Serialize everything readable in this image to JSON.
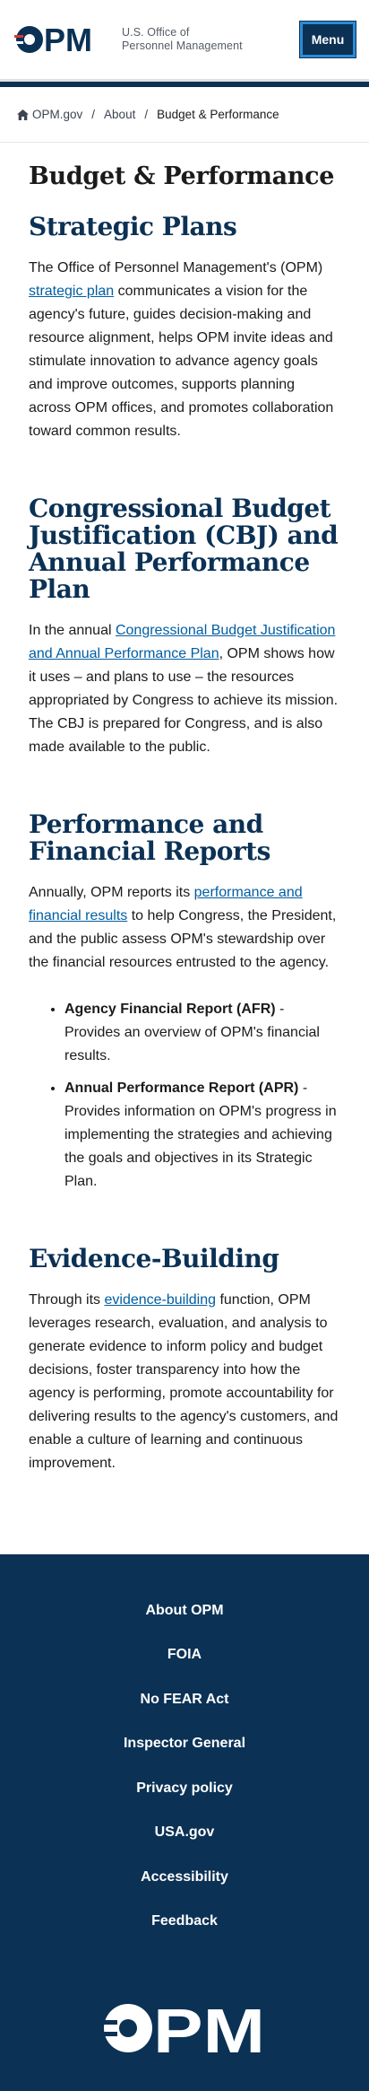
{
  "header": {
    "logo_text": "OPM",
    "org_line1": "U.S. Office of",
    "org_line2": "Personnel Management",
    "menu_label": "Menu"
  },
  "breadcrumb": {
    "home": "OPM.gov",
    "about": "About",
    "current": "Budget & Performance",
    "separator": "/"
  },
  "page": {
    "title": "Budget & Performance"
  },
  "sections": {
    "strategic": {
      "heading": "Strategic Plans",
      "text_before": "The Office of Personnel Management's (OPM) ",
      "link": "strategic plan",
      "text_after": " communicates a vision for the agency's future, guides decision-making and resource alignment, helps OPM invite ideas and stimulate innovation to advance agency goals and improve outcomes, supports planning across OPM offices, and promotes collaboration toward common results."
    },
    "cbj": {
      "heading": "Congressional Budget Justification (CBJ) and Annual Performance Plan",
      "text_before": "In the annual ",
      "link": "Congressional Budget Justification and Annual Performance Plan",
      "text_after": ", OPM shows how it uses – and plans to use – the resources appropriated by Congress to achieve its mission. The CBJ is prepared for Congress, and is also made available to the public."
    },
    "performance": {
      "heading": "Performance and Financial Reports",
      "text_before": "Annually, OPM reports its ",
      "link": "performance and financial results",
      "text_after": " to help Congress, the President, and the public assess OPM's stewardship over the financial resources entrusted to the agency.",
      "items": [
        {
          "title": "Agency Financial Report (AFR)",
          "desc": " - Provides an overview of OPM's financial results."
        },
        {
          "title": "Annual Performance Report (APR)",
          "desc": " - Provides information on OPM's progress in implementing the strategies and achieving the goals and objectives in its Strategic Plan."
        }
      ]
    },
    "evidence": {
      "heading": "Evidence-Building",
      "text_before": "Through its ",
      "link": "evidence-building",
      "text_after": " function, OPM leverages research, evaluation, and analysis to generate evidence to inform policy and budget decisions, foster transparency into how the agency is performing, promote accountability for delivering results to the agency's customers, and enable a culture of learning and continuous improvement."
    }
  },
  "footer": {
    "links": [
      "About OPM",
      "FOIA",
      "No FEAR Act",
      "Inspector General",
      "Privacy policy",
      "USA.gov",
      "Accessibility",
      "Feedback"
    ],
    "logo_text": "OPM"
  },
  "colors": {
    "navy": "#0b3155",
    "accent_red": "#d83933",
    "link": "#005ea2"
  }
}
